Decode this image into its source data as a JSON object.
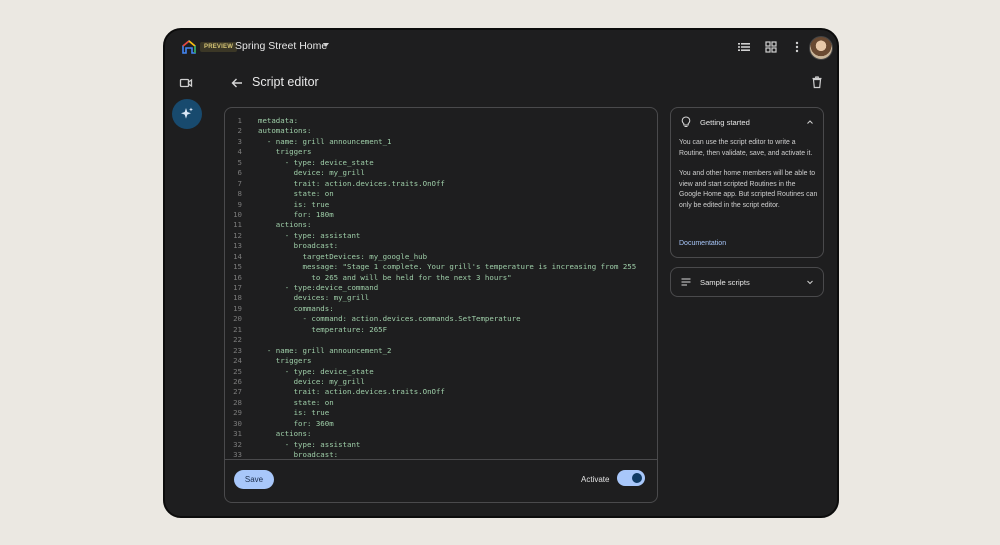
{
  "header": {
    "badge": "PREVIEW",
    "home_name": "Spring Street Home"
  },
  "page": {
    "title": "Script editor"
  },
  "editor": {
    "lines": [
      {
        "n": "1",
        "t": "metadata:"
      },
      {
        "n": "2",
        "t": "automations:"
      },
      {
        "n": "3",
        "t": "  - name: grill announcement_1"
      },
      {
        "n": "4",
        "t": "    triggers"
      },
      {
        "n": "5",
        "t": "      - type: device_state"
      },
      {
        "n": "6",
        "t": "        device: my_grill"
      },
      {
        "n": "7",
        "t": "        trait: action.devices.traits.OnOff"
      },
      {
        "n": "8",
        "t": "        state: on"
      },
      {
        "n": "9",
        "t": "        is: true"
      },
      {
        "n": "10",
        "t": "        for: 180m"
      },
      {
        "n": "11",
        "t": "    actions:"
      },
      {
        "n": "12",
        "t": "      - type: assistant"
      },
      {
        "n": "13",
        "t": "        broadcast:"
      },
      {
        "n": "14",
        "t": "          targetDevices: my_google_hub"
      },
      {
        "n": "15",
        "t": "          message: \"Stage 1 complete. Your grill's temperature is increasing from 255"
      },
      {
        "n": "16",
        "t": "            to 265 and will be held for the next 3 hours\""
      },
      {
        "n": "17",
        "t": "      - type:device_command"
      },
      {
        "n": "18",
        "t": "        devices: my_grill"
      },
      {
        "n": "19",
        "t": "        commands:"
      },
      {
        "n": "20",
        "t": "          - command: action.devices.commands.SetTemperature"
      },
      {
        "n": "21",
        "t": "            temperature: 265F"
      },
      {
        "n": "22",
        "t": ""
      },
      {
        "n": "23",
        "t": "  - name: grill announcement_2"
      },
      {
        "n": "24",
        "t": "    triggers"
      },
      {
        "n": "25",
        "t": "      - type: device_state"
      },
      {
        "n": "26",
        "t": "        device: my_grill"
      },
      {
        "n": "27",
        "t": "        trait: action.devices.traits.OnOff"
      },
      {
        "n": "28",
        "t": "        state: on"
      },
      {
        "n": "29",
        "t": "        is: true"
      },
      {
        "n": "30",
        "t": "        for: 360m"
      },
      {
        "n": "31",
        "t": "    actions:"
      },
      {
        "n": "32",
        "t": "      - type: assistant"
      },
      {
        "n": "33",
        "t": "        broadcast:"
      }
    ],
    "save_label": "Save",
    "activate_label": "Activate",
    "activate_on": true
  },
  "getting_started": {
    "title": "Getting started",
    "paragraph1": "You can use the script editor to write a Routine, then validate, save, and activate it.",
    "paragraph2": "You and other home members will be able to view and start scripted Routines in the Google Home app. But scripted Routines can only be edited in the script editor.",
    "link": "Documentation"
  },
  "sample_scripts": {
    "title": "Sample scripts"
  },
  "colors": {
    "code_text": "#9fcfa9",
    "accent": "#a8c7fa",
    "fab": "#184a6e"
  }
}
